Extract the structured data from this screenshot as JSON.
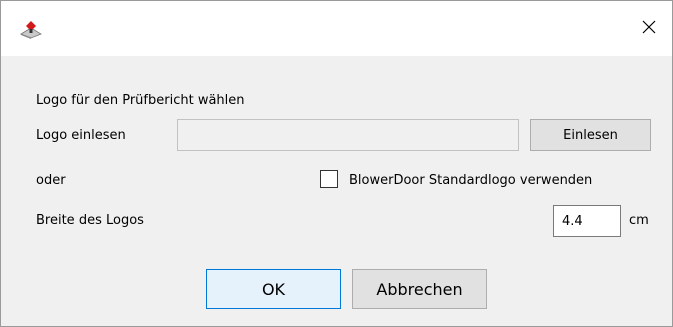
{
  "window": {
    "app_icon": "blowerdoor-app-icon",
    "close_icon": "close-icon"
  },
  "dialog": {
    "heading": "Logo für den Prüfbericht wählen",
    "logo_label": "Logo einlesen",
    "logo_path_value": "",
    "read_button": "Einlesen",
    "or_label": "oder",
    "standard_logo_label": "BlowerDoor Standardlogo verwenden",
    "standard_logo_checked": false,
    "width_label": "Breite des Logos",
    "width_value": "4.4",
    "width_unit": "cm",
    "ok_button": "OK",
    "cancel_button": "Abbrechen"
  },
  "colors": {
    "dialog_background": "#f0f0f0",
    "default_button_border": "#0078d7",
    "default_button_fill": "#e5f1fb"
  }
}
